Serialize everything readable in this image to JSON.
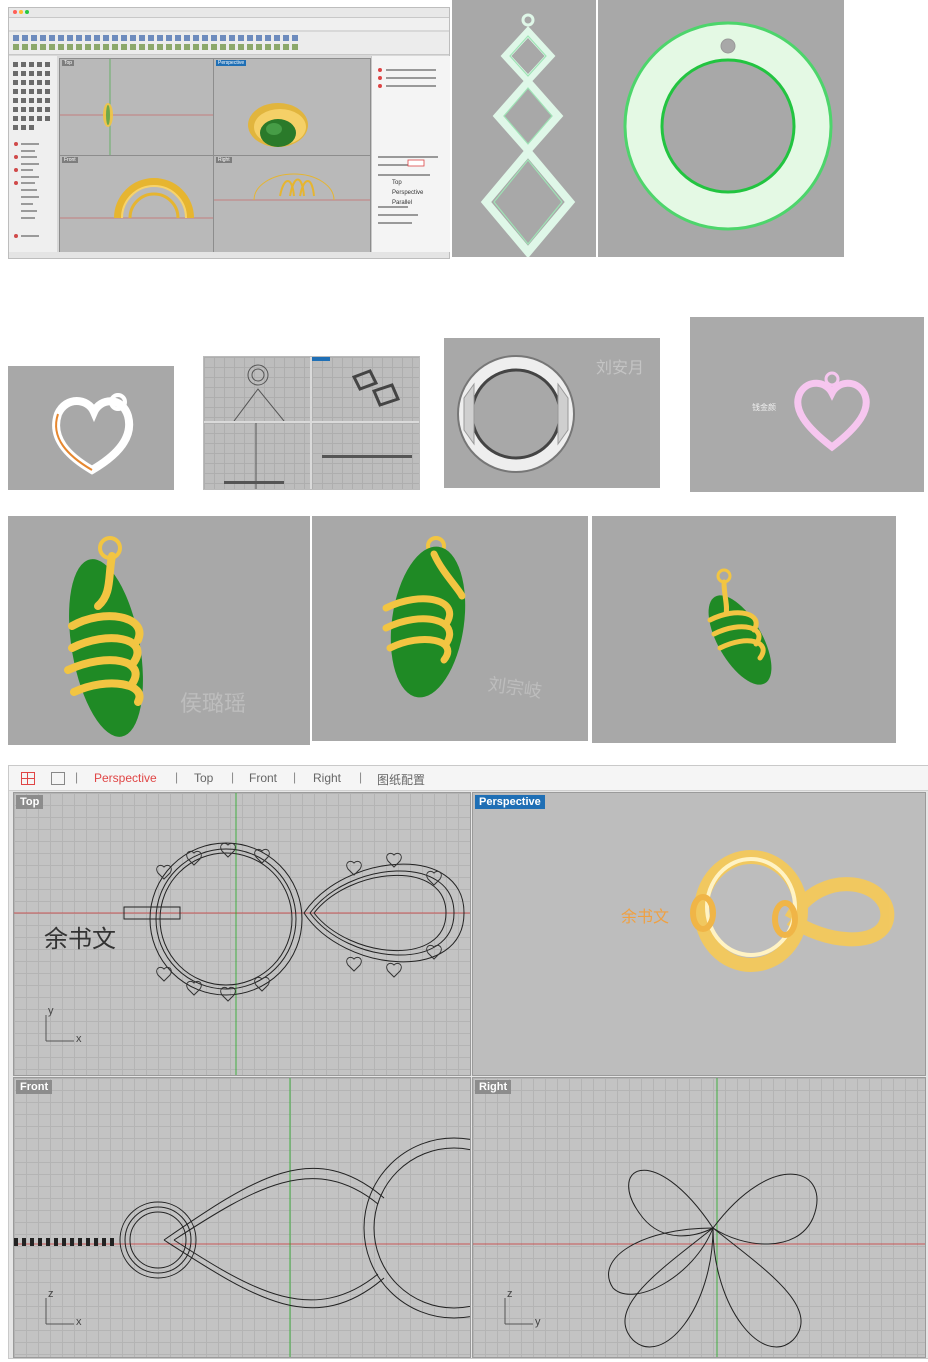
{
  "rhino_small": {
    "viewports": [
      "Top",
      "Perspective",
      "Front",
      "Right"
    ],
    "tabs": [
      "Perspective",
      "Top",
      "Front",
      "Right"
    ],
    "right_panel_items": [
      "Top",
      "Perspective",
      "Parallel"
    ]
  },
  "tiles": {
    "signature_1": "刘安月",
    "signature_2": "钱金颜",
    "signature_3": "侯璐瑶",
    "signature_4": "刘宗岐"
  },
  "rhino_big": {
    "tabs": [
      "Perspective",
      "Top",
      "Front",
      "Right",
      "图纸配置"
    ],
    "viewport_labels": {
      "top": "Top",
      "perspective": "Perspective",
      "front": "Front",
      "right": "Right"
    },
    "text_label": "余书文",
    "axes": {
      "top": [
        "y",
        "x"
      ],
      "front": [
        "z",
        "x"
      ],
      "right": [
        "z",
        "y"
      ]
    }
  },
  "colors": {
    "active_tab": "#e04646",
    "active_viewport_label": "#1f6fb5",
    "gold": "#f2c542",
    "jade_green": "#1f8a25",
    "mint": "#dff7e8",
    "pink": "#f6c6ef"
  }
}
